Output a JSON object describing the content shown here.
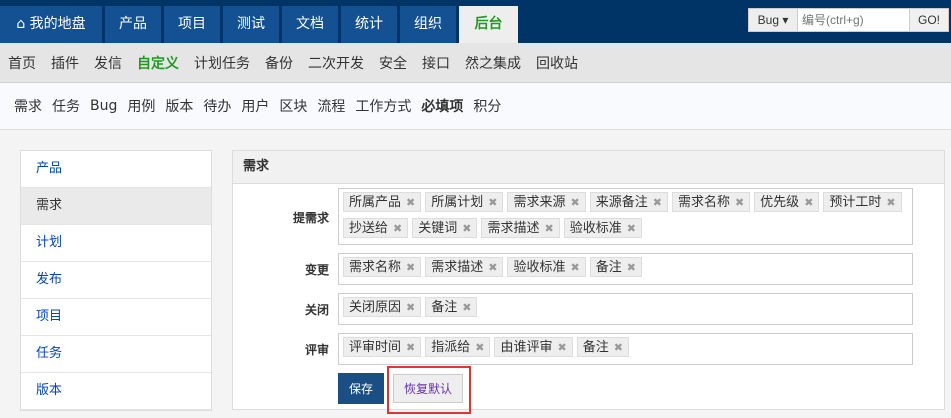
{
  "top_tabs": [
    {
      "label": "我的地盘",
      "icon": "home-icon"
    },
    {
      "label": "产品"
    },
    {
      "label": "项目"
    },
    {
      "label": "测试"
    },
    {
      "label": "文档"
    },
    {
      "label": "统计"
    },
    {
      "label": "组织"
    },
    {
      "label": "后台",
      "active": true
    }
  ],
  "search": {
    "type": "Bug ▾",
    "placeholder": "编号(ctrl+g)",
    "go": "GO!"
  },
  "subnav": [
    "首页",
    "插件",
    "发信",
    "自定义",
    "计划任务",
    "备份",
    "二次开发",
    "安全",
    "接口",
    "然之集成",
    "回收站"
  ],
  "subnav_active": "自定义",
  "module_nav": [
    "需求",
    "任务",
    "Bug",
    "用例",
    "版本",
    "待办",
    "用户",
    "区块",
    "流程",
    "工作方式",
    "必填项",
    "积分"
  ],
  "sidebar": [
    "产品",
    "需求",
    "计划",
    "发布",
    "项目",
    "任务",
    "版本"
  ],
  "sidebar_active": "需求",
  "panel": {
    "title": "需求",
    "rows": [
      {
        "label": "提需求",
        "fields": [
          "所属产品",
          "所属计划",
          "需求来源",
          "来源备注",
          "需求名称",
          "优先级",
          "预计工时",
          "抄送给",
          "关键词",
          "需求描述",
          "验收标准"
        ]
      },
      {
        "label": "变更",
        "fields": [
          "需求名称",
          "需求描述",
          "验收标准",
          "备注"
        ]
      },
      {
        "label": "关闭",
        "fields": [
          "关闭原因",
          "备注"
        ]
      },
      {
        "label": "评审",
        "fields": [
          "评审时间",
          "指派给",
          "由谁评审",
          "备注"
        ]
      }
    ],
    "save": "保存",
    "restore": "恢复默认"
  },
  "colors": {
    "top": "#003366",
    "tab": "#135193",
    "active_green": "#229922",
    "highlight": "#e53333"
  }
}
